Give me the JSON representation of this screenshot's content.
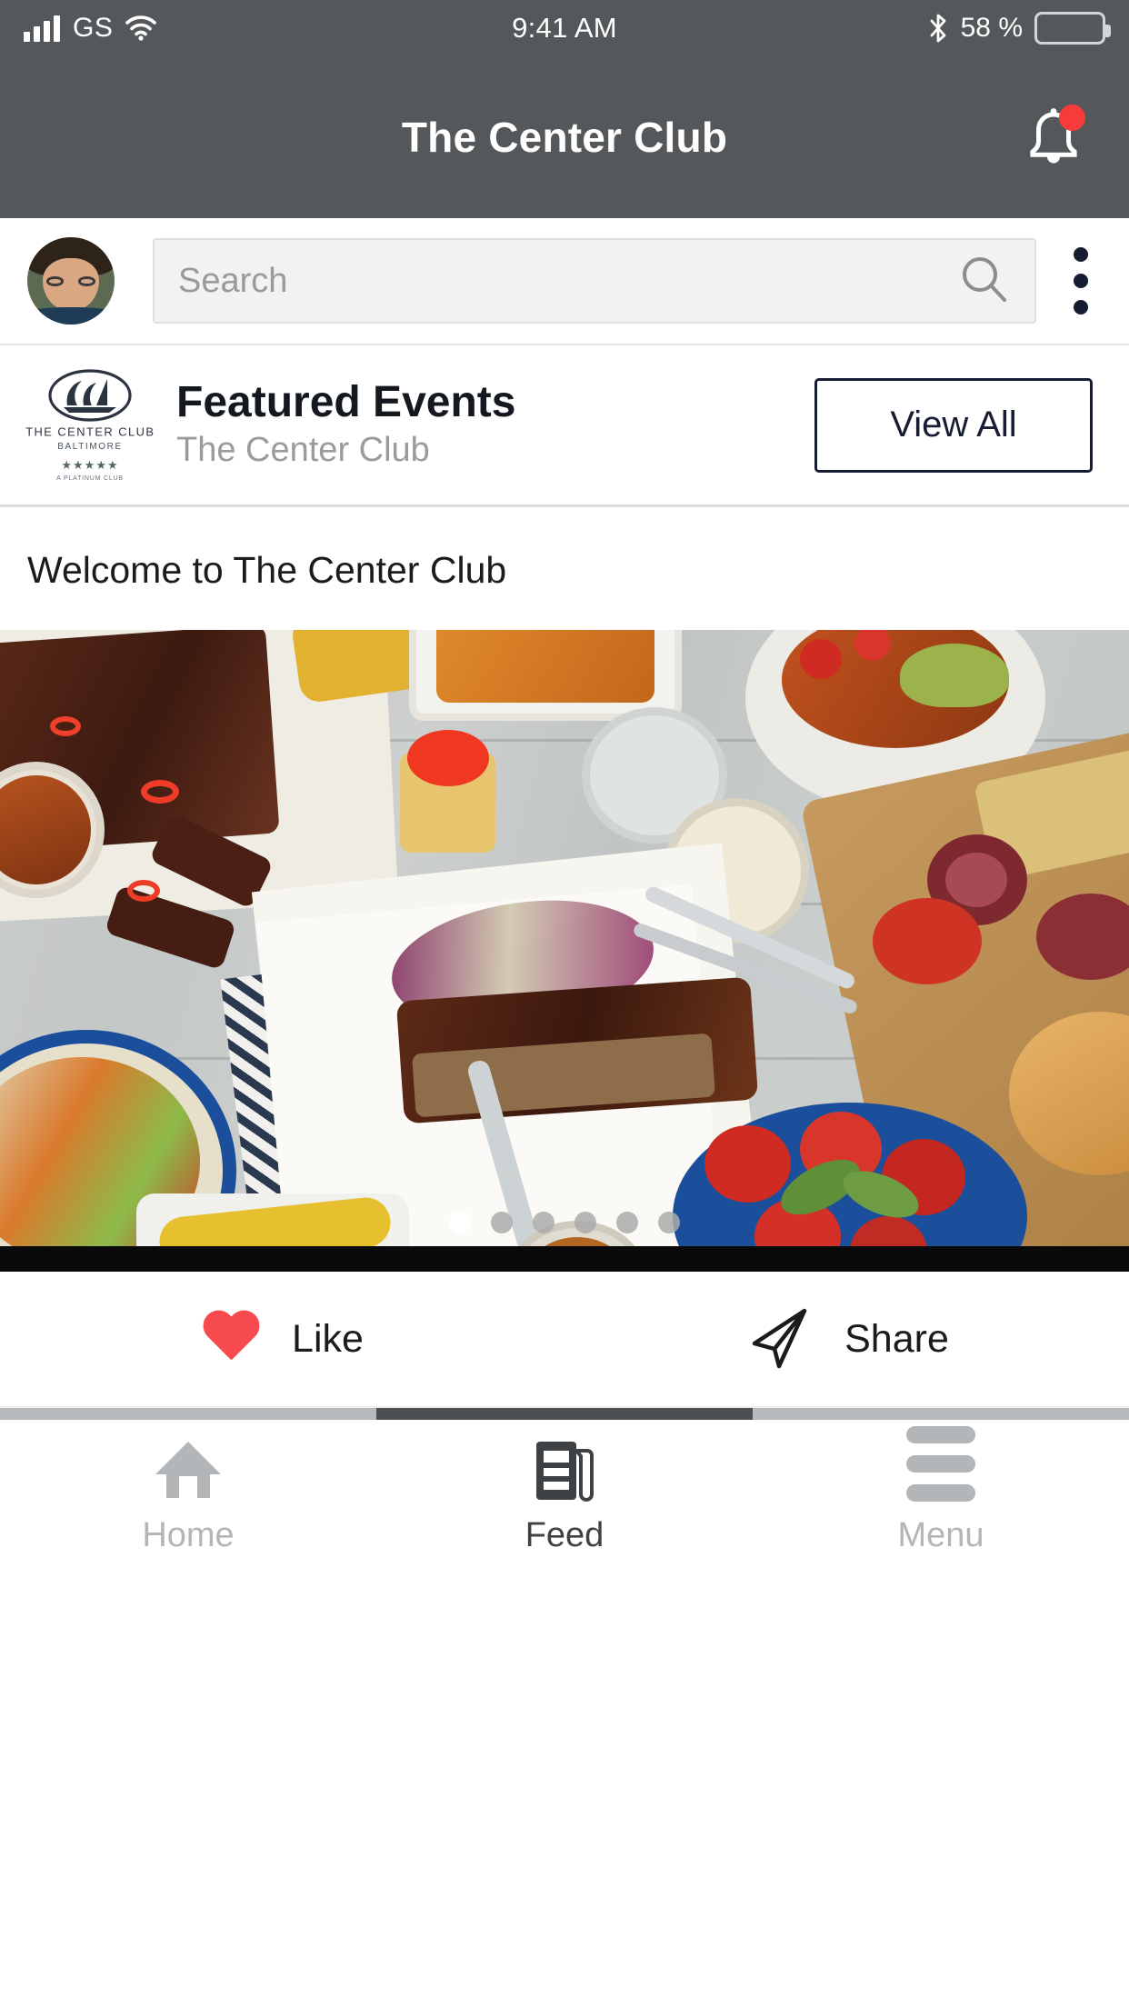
{
  "status_bar": {
    "carrier": "GS",
    "time": "9:41 AM",
    "battery_percent": "58 %",
    "battery_level": 58,
    "icons": [
      "signal-icon",
      "wifi-icon",
      "bluetooth-icon",
      "battery-icon"
    ]
  },
  "nav": {
    "title": "The Center Club",
    "notification_badge": true,
    "badge_color": "#f73a3a",
    "bar_color": "#54585a"
  },
  "search": {
    "value": "",
    "placeholder": "Search",
    "icon": "search-icon",
    "overflow_icon": "kebab-menu-icon",
    "avatar": "user-avatar"
  },
  "featured": {
    "logo": {
      "name": "THE CENTER CLUB",
      "city": "BALTIMORE",
      "stars": "★★★★★",
      "tagline": "A PLATINUM CLUB"
    },
    "title": "Featured Events",
    "subtitle": "The Center Club",
    "view_all_label": "View All"
  },
  "post": {
    "title": "Welcome to The Center Club",
    "image_alt": "barbecue-spread-photo",
    "carousel": {
      "total": 6,
      "active_index": 0
    }
  },
  "actions": [
    {
      "label": "Like",
      "icon": "heart-icon",
      "color": "#f74a4f"
    },
    {
      "label": "Share",
      "icon": "send-icon",
      "color": "#1b1b1b"
    }
  ],
  "tabbar": {
    "items": [
      {
        "label": "Home",
        "icon": "home-icon",
        "active": false
      },
      {
        "label": "Feed",
        "icon": "feed-icon",
        "active": true
      },
      {
        "label": "Menu",
        "icon": "hamburger-icon",
        "active": false
      }
    ],
    "active_index": 1,
    "active_color": "#4c5053",
    "inactive_color": "#b3b6b9"
  }
}
